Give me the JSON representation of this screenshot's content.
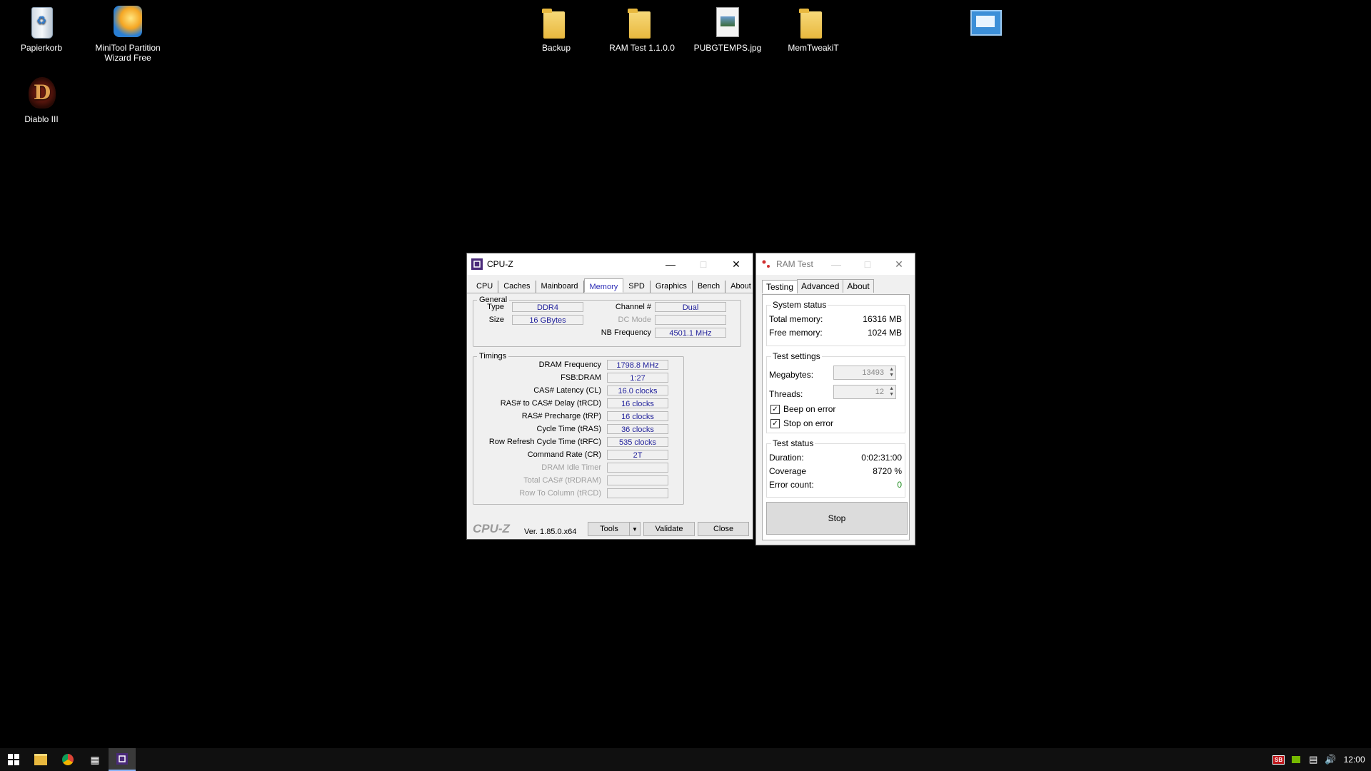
{
  "desktop": {
    "icons": [
      {
        "label": "Papierkorb"
      },
      {
        "label": "MiniTool Partition Wizard Free"
      },
      {
        "label": "Diablo III"
      },
      {
        "label": "Backup"
      },
      {
        "label": "RAM Test 1.1.0.0"
      },
      {
        "label": "PUBGTEMPS.jpg"
      },
      {
        "label": "MemTweakiT"
      }
    ]
  },
  "cpuz": {
    "title": "CPU-Z",
    "tabs": [
      "CPU",
      "Caches",
      "Mainboard",
      "Memory",
      "SPD",
      "Graphics",
      "Bench",
      "About"
    ],
    "active_tab": "Memory",
    "general": {
      "legend": "General",
      "type_label": "Type",
      "type_value": "DDR4",
      "size_label": "Size",
      "size_value": "16 GBytes",
      "channel_label": "Channel #",
      "channel_value": "Dual",
      "dcmode_label": "DC Mode",
      "dcmode_value": "",
      "nbfreq_label": "NB Frequency",
      "nbfreq_value": "4501.1 MHz"
    },
    "timings": {
      "legend": "Timings",
      "rows": [
        {
          "label": "DRAM Frequency",
          "value": "1798.8 MHz",
          "dim": false
        },
        {
          "label": "FSB:DRAM",
          "value": "1:27",
          "dim": false
        },
        {
          "label": "CAS# Latency (CL)",
          "value": "16.0 clocks",
          "dim": false
        },
        {
          "label": "RAS# to CAS# Delay (tRCD)",
          "value": "16 clocks",
          "dim": false
        },
        {
          "label": "RAS# Precharge (tRP)",
          "value": "16 clocks",
          "dim": false
        },
        {
          "label": "Cycle Time (tRAS)",
          "value": "36 clocks",
          "dim": false
        },
        {
          "label": "Row Refresh Cycle Time (tRFC)",
          "value": "535 clocks",
          "dim": false
        },
        {
          "label": "Command Rate (CR)",
          "value": "2T",
          "dim": false
        },
        {
          "label": "DRAM Idle Timer",
          "value": "",
          "dim": true
        },
        {
          "label": "Total CAS# (tRDRAM)",
          "value": "",
          "dim": true
        },
        {
          "label": "Row To Column (tRCD)",
          "value": "",
          "dim": true
        }
      ]
    },
    "footer": {
      "logo": "CPU-Z",
      "version": "Ver. 1.85.0.x64",
      "tools_label": "Tools",
      "validate_label": "Validate",
      "close_label": "Close"
    }
  },
  "ramtest": {
    "title": "RAM Test",
    "tabs": [
      "Testing",
      "Advanced",
      "About"
    ],
    "system_status": {
      "heading": "System status",
      "total_label": "Total memory:",
      "total_value": "16316 MB",
      "free_label": "Free memory:",
      "free_value": "1024 MB"
    },
    "test_settings": {
      "heading": "Test settings",
      "megabytes_label": "Megabytes:",
      "megabytes_value": "13493",
      "threads_label": "Threads:",
      "threads_value": "12",
      "beep_label": "Beep on error",
      "beep_checked": true,
      "stop_label": "Stop on error",
      "stop_checked": true
    },
    "test_status": {
      "heading": "Test status",
      "duration_label": "Duration:",
      "duration_value": "0:02:31:00",
      "coverage_label": "Coverage",
      "coverage_value": "8720 %",
      "errors_label": "Error count:",
      "errors_value": "0"
    },
    "stop_label": "Stop"
  },
  "taskbar": {
    "clock": "12:00",
    "tray_badge": "SB"
  },
  "colors": {
    "value_text": "#1e1e9a",
    "active_tab": "#2b2bb5",
    "error_zero": "#1a8a1a"
  }
}
